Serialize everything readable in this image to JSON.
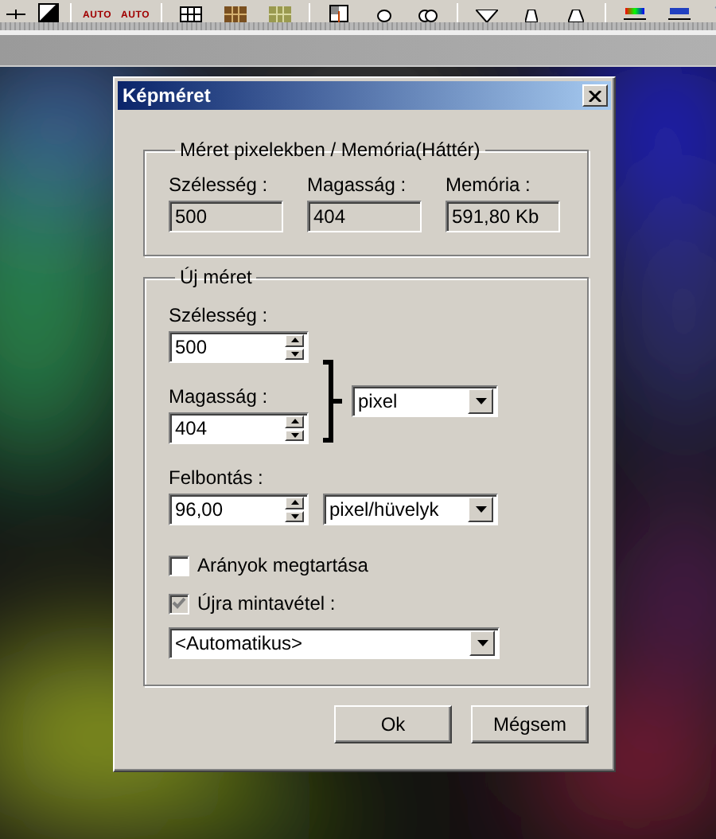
{
  "toolbar": {
    "auto_labels": [
      "AUTO",
      "AUTO"
    ]
  },
  "dialog": {
    "title": "Képméret",
    "current_size": {
      "legend": "Méret pixelekben / Memória(Háttér)",
      "fields": [
        {
          "label": "Szélesség :",
          "value": "500"
        },
        {
          "label": "Magasság :",
          "value": "404"
        },
        {
          "label": "Memória :",
          "value": "591,80 Kb"
        }
      ]
    },
    "new_size": {
      "legend": "Új méret",
      "width": {
        "label": "Szélesség :",
        "value": "500"
      },
      "height": {
        "label": "Magasság :",
        "value": "404"
      },
      "unit": "pixel",
      "resolution": {
        "label": "Felbontás :",
        "value": "96,00",
        "unit": "pixel/hüvelyk"
      },
      "checkboxes": [
        {
          "label": "Arányok megtartása",
          "checked": false,
          "disabled": false
        },
        {
          "label": "Újra mintavétel :",
          "checked": true,
          "disabled": true
        }
      ],
      "resample": "<Automatikus>"
    },
    "buttons": [
      "Ok",
      "Mégsem"
    ]
  }
}
